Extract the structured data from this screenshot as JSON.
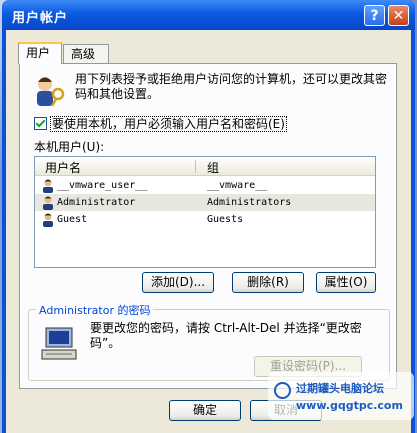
{
  "window": {
    "title": "用户帐户",
    "help_glyph": "?",
    "close_glyph": "✕"
  },
  "tabs": [
    {
      "label": "用户"
    },
    {
      "label": "高级"
    }
  ],
  "users_tab": {
    "description": "用下列表授予或拒绝用户访问您的计算机，还可以更改其密码和其他设置。",
    "require_password_checkbox": {
      "label": "要使用本机，用户必须输入用户名和密码(E)",
      "checked": true
    },
    "local_users_label": "本机用户(U):",
    "columns": [
      "用户名",
      "组"
    ],
    "rows": [
      {
        "user": "__vmware_user__",
        "group": "__vmware__",
        "selected": false
      },
      {
        "user": "Administrator",
        "group": "Administrators",
        "selected": true
      },
      {
        "user": "Guest",
        "group": "Guests",
        "selected": false
      }
    ],
    "buttons": {
      "add": "添加(D)...",
      "remove": "删除(R)",
      "properties": "属性(O)"
    },
    "password_group": {
      "title": "Administrator 的密码",
      "text": "要更改您的密码，请按 Ctrl-Alt-Del 并选择“更改密码”。",
      "reset_button": "重设密码(P)..."
    }
  },
  "footer_buttons": {
    "ok": "确定",
    "cancel": "取消"
  },
  "watermark": {
    "line1": "过期罐头电脑论坛",
    "line2": "www.gqgtpc.com"
  },
  "colors": {
    "titlebar": "#0a5ae2",
    "dialog_bg": "#ece9d8",
    "accent_tab": "#ffc83c",
    "group_title": "#0046d5"
  }
}
